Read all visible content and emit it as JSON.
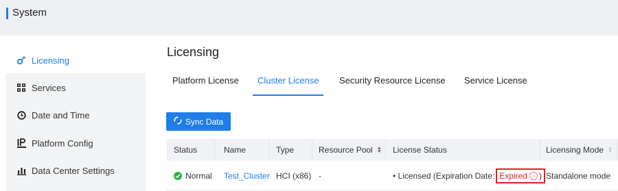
{
  "app": {
    "title": "System"
  },
  "sidebar": {
    "items": [
      {
        "label": "Licensing",
        "icon": "license-key-icon",
        "active": true
      },
      {
        "label": "Services",
        "icon": "grid-icon",
        "active": false
      },
      {
        "label": "Date and Time",
        "icon": "clock-icon",
        "active": false
      },
      {
        "label": "Platform Config",
        "icon": "platform-config-icon",
        "active": false
      },
      {
        "label": "Data Center Settings",
        "icon": "bar-chart-icon",
        "active": false
      }
    ]
  },
  "main": {
    "title": "Licensing",
    "tabs": [
      {
        "label": "Platform License"
      },
      {
        "label": "Cluster License"
      },
      {
        "label": "Security Resource License"
      },
      {
        "label": "Service License"
      }
    ],
    "active_tab": "Cluster License",
    "sync_button": {
      "label": "Sync Data",
      "icon": "sync-icon"
    }
  },
  "table": {
    "columns": [
      "Status",
      "Name",
      "Type",
      "Resource Pool",
      "License Status",
      "Licensing Mode"
    ],
    "rows": [
      {
        "status": "Normal",
        "name": "Test_Cluster",
        "type": "HCI (x86)",
        "resource_pool": "-",
        "license_status_prefix": "• Licensed (Expiration Date:",
        "license_status_value": "Expired",
        "license_status_suffix": ")",
        "licensing_mode": "Standalone mode"
      }
    ]
  },
  "colors": {
    "accent": "#1f7ee8",
    "success": "#2bb24c",
    "danger": "#e02020"
  }
}
